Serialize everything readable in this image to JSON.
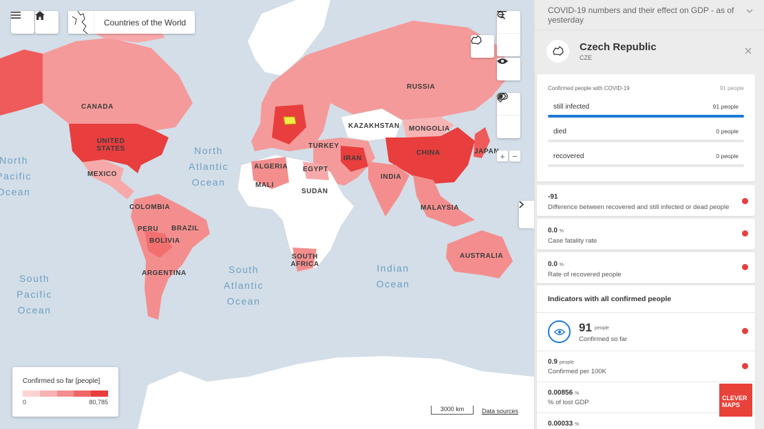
{
  "map": {
    "title": "Countries of the World",
    "oceans": [
      {
        "id": "north-pacific",
        "text": "North Pacific Ocean"
      },
      {
        "id": "north-atlantic",
        "text": "North Atlantic Ocean"
      },
      {
        "id": "south-atlantic",
        "text": "South Atlantic Ocean"
      },
      {
        "id": "south-pacific",
        "text": "South Pacific Ocean"
      },
      {
        "id": "indian",
        "text": "Indian Ocean"
      }
    ],
    "countries": {
      "canada": "CANADA",
      "usa": "UNITED STATES",
      "mexico": "MEXICO",
      "colombia": "COLOMBIA",
      "peru": "PERU",
      "brazil": "BRAZIL",
      "bolivia": "BOLIVIA",
      "argentina": "ARGENTINA",
      "russia": "RUSSIA",
      "kazakhstan": "KAZAKHSTAN",
      "mongolia": "MONGOLIA",
      "china": "CHINA",
      "japan": "JAPAN",
      "turkey": "TURKEY",
      "iran": "IRAN",
      "india": "INDIA",
      "malaysia": "MALAYSIA",
      "algeria": "ALGERIA",
      "egypt": "EGYPT",
      "mali": "MALI",
      "sudan": "SUDAN",
      "south_africa": "SOUTH AFRICA",
      "australia": "AUSTRALIA"
    },
    "legend": {
      "title": "Confirmed so far [people]",
      "min": "0",
      "max": "80,785",
      "colors": [
        "#fbd3d3",
        "#f8b3b3",
        "#f48e8e",
        "#ef6666",
        "#e83e3e"
      ]
    },
    "scale": "3000 km",
    "data_sources": "Data sources",
    "zoom_in": "+",
    "zoom_out": "−"
  },
  "panel": {
    "header": "COVID-19 numbers and their effect on GDP - as of yesterday",
    "country_name": "Czech Republic",
    "country_code": "CZE",
    "confirmed_label": "Confirmed people with COVID-19",
    "confirmed_value": "91 people",
    "breakdown": [
      {
        "label": "still infected",
        "value": "91 people",
        "fraction": 1.0
      },
      {
        "label": "died",
        "value": "0 people",
        "fraction": 0.0
      },
      {
        "label": "recovered",
        "value": "0 people",
        "fraction": 0.0
      }
    ],
    "indicators": [
      {
        "value": "-91",
        "unit": "",
        "desc": "Difference between recovered and still infected or dead people"
      },
      {
        "value": "0.0",
        "unit": "%",
        "desc": "Case fatality rate"
      },
      {
        "value": "0.0",
        "unit": "%",
        "desc": "Rate of recovered people"
      }
    ],
    "all_confirmed": {
      "title": "Indicators with all confirmed people",
      "big_value": "91",
      "big_unit": "people",
      "big_label": "Confirmed so far",
      "rows": [
        {
          "value": "0.9",
          "unit": "people",
          "desc": "Confirmed per 100K"
        },
        {
          "value": "0.00856",
          "unit": "%",
          "desc": "% of lost GDP"
        },
        {
          "value": "0.00033",
          "unit": "%",
          "desc": ""
        }
      ]
    },
    "logo_text": "CLEVER MAPS",
    "accent": "#1e7ad6",
    "indicator_dot": "#e83e3e"
  }
}
